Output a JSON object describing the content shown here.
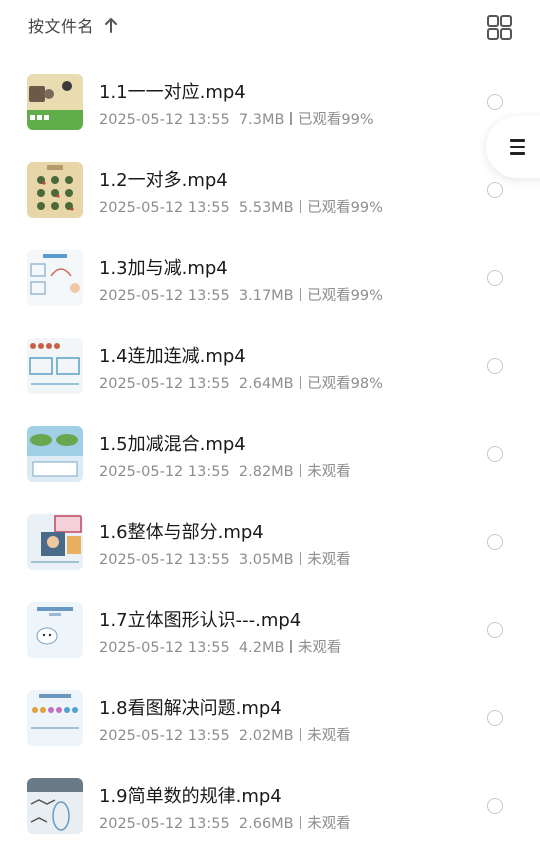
{
  "header": {
    "sort_label": "按文件名",
    "sort_icon": "arrow-up-icon",
    "view_toggle_icon": "grid-view-icon"
  },
  "side_handle": {
    "icon": "menu-icon"
  },
  "files": [
    {
      "title": "1.1一一对应.mp4",
      "date": "2025-05-12 13:55",
      "size": "7.3MB",
      "status": "已观看99%"
    },
    {
      "title": "1.2一对多.mp4",
      "date": "2025-05-12 13:55",
      "size": "5.53MB",
      "status": "已观看99%"
    },
    {
      "title": "1.3加与减.mp4",
      "date": "2025-05-12 13:55",
      "size": "3.17MB",
      "status": "已观看99%"
    },
    {
      "title": "1.4连加连减.mp4",
      "date": "2025-05-12 13:55",
      "size": "2.64MB",
      "status": "已观看98%"
    },
    {
      "title": "1.5加减混合.mp4",
      "date": "2025-05-12 13:55",
      "size": "2.82MB",
      "status": "未观看"
    },
    {
      "title": "1.6整体与部分.mp4",
      "date": "2025-05-12 13:55",
      "size": "3.05MB",
      "status": "未观看"
    },
    {
      "title": "1.7立体图形认识---.mp4",
      "date": "2025-05-12 13:55",
      "size": "4.2MB",
      "status": "未观看"
    },
    {
      "title": "1.8看图解决问题.mp4",
      "date": "2025-05-12 13:55",
      "size": "2.02MB",
      "status": "未观看"
    },
    {
      "title": "1.9简单数的规律.mp4",
      "date": "2025-05-12 13:55",
      "size": "2.66MB",
      "status": "未观看"
    }
  ]
}
